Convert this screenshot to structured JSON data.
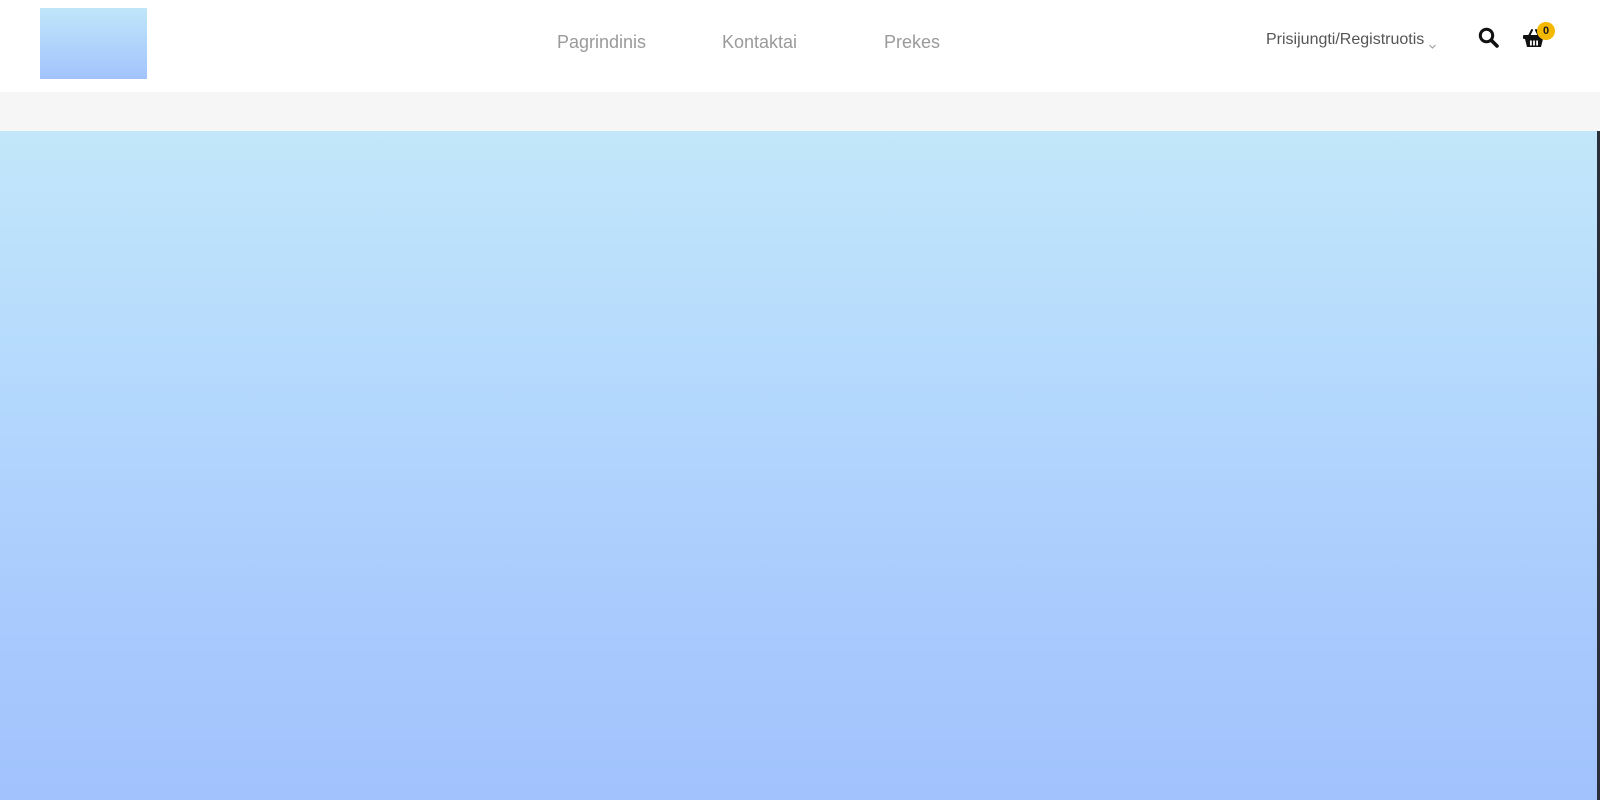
{
  "header": {
    "nav": [
      {
        "label": "Pagrindinis"
      },
      {
        "label": "Kontaktai"
      },
      {
        "label": "Prekes"
      }
    ],
    "account_label": "Prisijungti/Registruotis",
    "cart_count": "0",
    "icons": {
      "logo": "logo-image",
      "account": "chevron-down-icon",
      "search": "search-icon",
      "cart": "basket-icon"
    }
  },
  "colors": {
    "nav_text": "#9a9a9a",
    "account_text": "#555555",
    "badge": "#f5b800",
    "band": "#f6f6f6",
    "hero_top": "#c2e7fa",
    "hero_bottom": "#a1c2fd"
  }
}
